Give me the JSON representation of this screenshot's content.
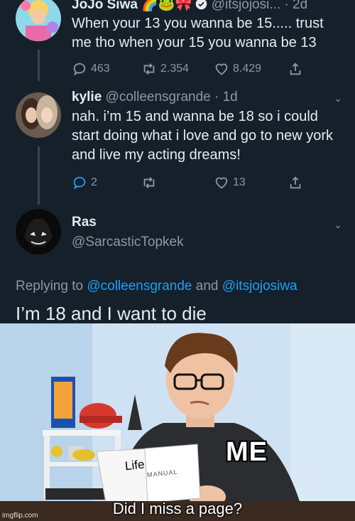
{
  "tweets": [
    {
      "name": "JoJo Siwa",
      "name_emojis": "🌈🐸🎀",
      "verified": true,
      "handle": "@itsjojosi...",
      "time": "· 2d",
      "text": "When your 13 you wanna be 15..... trust me tho when your 15 you wanna be 13",
      "replies": "463",
      "retweets": "2.354",
      "likes": "8.429"
    },
    {
      "name": "kylie",
      "handle": "@colleensgrande",
      "time": "· 1d",
      "text": "nah. i’m 15 and wanna be 18 so i could start doing what i love and go to new york and live my acting dreams!",
      "replies": "2",
      "retweets": "",
      "likes": "13"
    },
    {
      "name": "Ras",
      "handle": "@SarcasticTopkek"
    }
  ],
  "reply": {
    "prefix": "Replying to",
    "mention1": "@colleensgrande",
    "joiner": "and",
    "mention2": "@itsjojosiwa",
    "text": "I’m 18 and I want to die"
  },
  "meme": {
    "label_me": "ME",
    "label_life": "Life",
    "label_manual": "MANUAL",
    "caption": "Did I miss a page?",
    "watermark": "imgflip.com"
  },
  "icons": [
    "reply-icon",
    "retweet-icon",
    "like-icon",
    "share-icon",
    "verified-icon",
    "caret-down-icon"
  ],
  "colors": {
    "background": "#15202b",
    "text": "#e6ecf0",
    "muted": "#8899a6",
    "link": "#1da1f2"
  }
}
